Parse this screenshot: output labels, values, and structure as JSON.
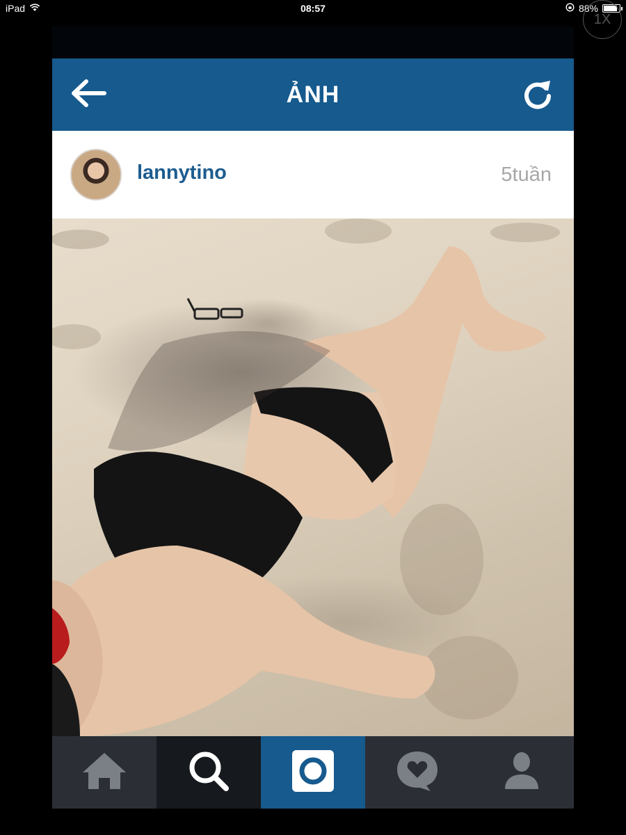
{
  "status_bar": {
    "device": "iPad",
    "time": "08:57",
    "battery": "88%",
    "battery_level": 0.88
  },
  "zoom_badge": "1X",
  "header": {
    "title": "ẢNH",
    "back_icon": "arrow-left-icon",
    "refresh_icon": "refresh-icon"
  },
  "post": {
    "username": "lannytino",
    "time_ago": "5tuần",
    "photo_description": ""
  },
  "tabbar": {
    "tabs": [
      "home-icon",
      "search-icon",
      "camera-icon",
      "activity-icon",
      "profile-icon"
    ],
    "active_tab": "camera-icon"
  },
  "colors": {
    "brand_blue": "#165a8e",
    "tab_dark": "#2b2f35",
    "username_blue": "#1d5d90",
    "timestamp_gray": "#a7a7a7"
  }
}
